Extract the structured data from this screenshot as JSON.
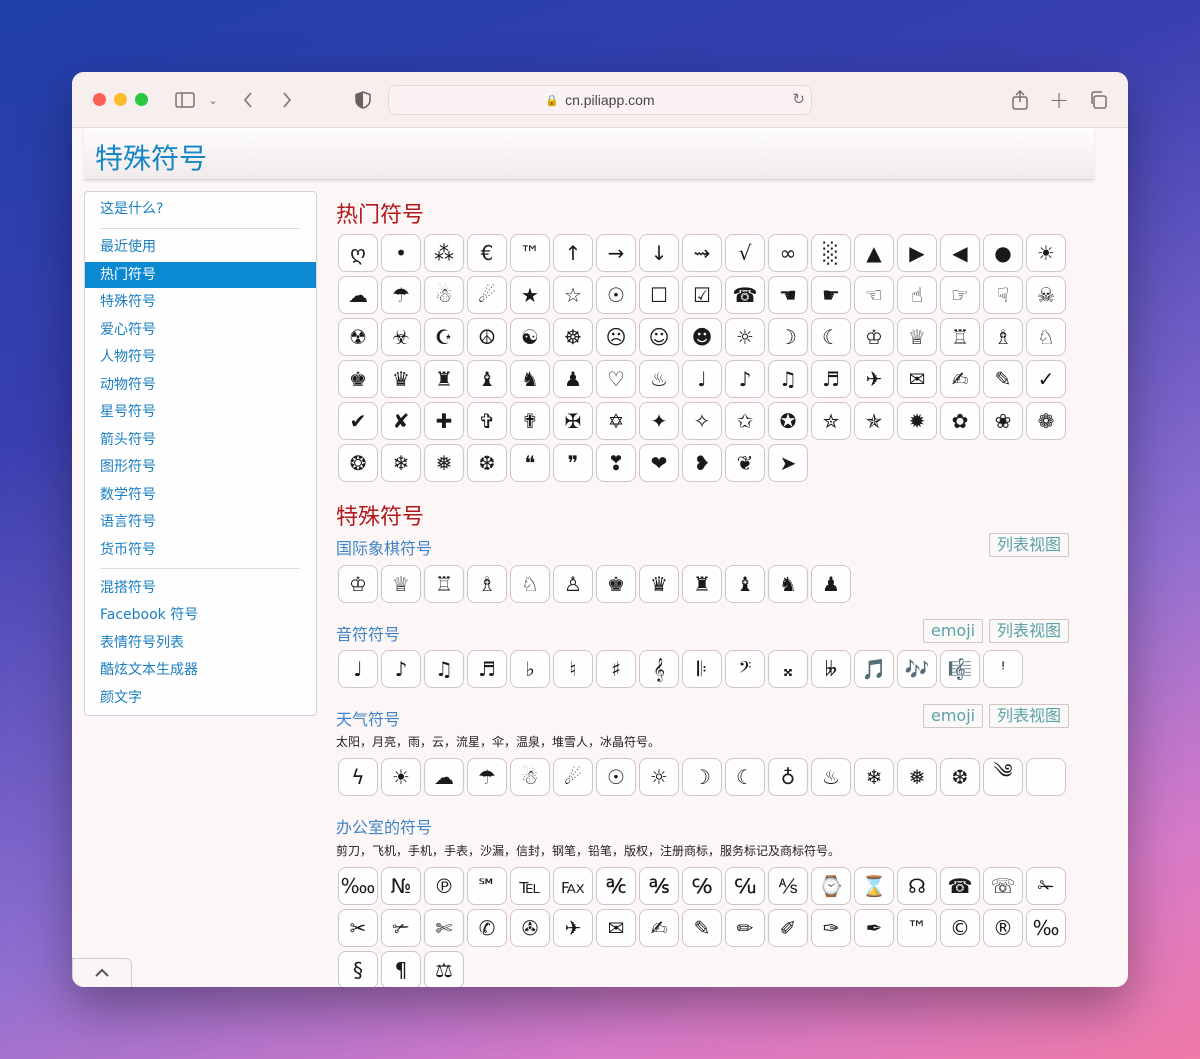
{
  "browser": {
    "url": "cn.piliapp.com"
  },
  "page": {
    "title": "特殊符号"
  },
  "sidebar": {
    "items": [
      {
        "label": "这是什么?"
      },
      {
        "label": "最近使用"
      },
      {
        "label": "热门符号",
        "active": true
      },
      {
        "label": "特殊符号"
      },
      {
        "label": "爱心符号"
      },
      {
        "label": "人物符号"
      },
      {
        "label": "动物符号"
      },
      {
        "label": "星号符号"
      },
      {
        "label": "箭头符号"
      },
      {
        "label": "图形符号"
      },
      {
        "label": "数学符号"
      },
      {
        "label": "语言符号"
      },
      {
        "label": "货币符号"
      },
      {
        "label": "混搭符号"
      },
      {
        "label": "Facebook 符号"
      },
      {
        "label": "表情符号列表"
      },
      {
        "label": "酷炫文本生成器"
      },
      {
        "label": "颜文字"
      }
    ]
  },
  "popular": {
    "heading": "热门符号",
    "symbols": [
      "ღ",
      "•",
      "⁂",
      "€",
      "™",
      "↑",
      "→",
      "↓",
      "⇝",
      "√",
      "∞",
      "░",
      "▲",
      "▶",
      "◀",
      "●",
      "☀",
      "☁",
      "☂",
      "☃",
      "☄",
      "★",
      "☆",
      "☉",
      "☐",
      "☑",
      "☎",
      "☚",
      "☛",
      "☜",
      "☝",
      "☞",
      "☟",
      "☠",
      "☢",
      "☣",
      "☪",
      "☮",
      "☯",
      "☸",
      "☹",
      "☺",
      "☻",
      "☼",
      "☽",
      "☾",
      "♔",
      "♕",
      "♖",
      "♗",
      "♘",
      "♚",
      "♛",
      "♜",
      "♝",
      "♞",
      "♟",
      "♡",
      "♨",
      "♩",
      "♪",
      "♫",
      "♬",
      "✈",
      "✉",
      "✍",
      "✎",
      "✓",
      "✔",
      "✘",
      "✚",
      "✞",
      "✟",
      "✠",
      "✡",
      "✦",
      "✧",
      "✩",
      "✪",
      "✮",
      "✯",
      "✹",
      "✿",
      "❀",
      "❁",
      "❂",
      "❄",
      "❅",
      "❆",
      "❝",
      "❞",
      "❣",
      "❤",
      "❥",
      "❦",
      "➤"
    ]
  },
  "special": {
    "heading": "特殊符号",
    "chess": {
      "title": "国际象棋符号",
      "list_button": "列表视图",
      "symbols": [
        "♔",
        "♕",
        "♖",
        "♗",
        "♘",
        "♙",
        "♚",
        "♛",
        "♜",
        "♝",
        "♞",
        "♟"
      ]
    },
    "music": {
      "title": "音符符号",
      "emoji_button": "emoji",
      "list_button": "列表视图",
      "symbols": [
        "♩",
        "♪",
        "♫",
        "♬",
        "♭",
        "♮",
        "♯",
        "𝄞",
        "𝄆",
        "𝄢",
        "𝄪",
        "𝄫",
        "🎵",
        "🎶",
        "🎼",
        "ꜝ"
      ]
    },
    "weather": {
      "title": "天气符号",
      "emoji_button": "emoji",
      "list_button": "列表视图",
      "description": "太阳，月亮，雨，云，流星，伞，温泉，堆雪人，冰晶符号。",
      "symbols": [
        "ϟ",
        "☀",
        "☁",
        "☂",
        "☃",
        "☄",
        "☉",
        "☼",
        "☽",
        "☾",
        "♁",
        "♨",
        "❄",
        "❅",
        "❆",
        "༄",
        ""
      ]
    },
    "office": {
      "title": "办公室的符号",
      "description": "剪刀，飞机，手机，手表，沙漏，信封，钢笔，铅笔，版权，注册商标，服务标记及商标符号。",
      "symbols": [
        "‱",
        "№",
        "℗",
        "℠",
        "℡",
        "℻",
        "℀",
        "℁",
        "℅",
        "℆",
        "⅍",
        "⌚",
        "⌛",
        "☊",
        "☎",
        "☏",
        "✁",
        "✂",
        "✃",
        "✄",
        "✆",
        "✇",
        "✈",
        "✉",
        "✍",
        "✎",
        "✏",
        "✐",
        "✑",
        "✒",
        "™",
        "©",
        "®",
        "‰",
        "§",
        "¶",
        "⚖"
      ]
    }
  }
}
